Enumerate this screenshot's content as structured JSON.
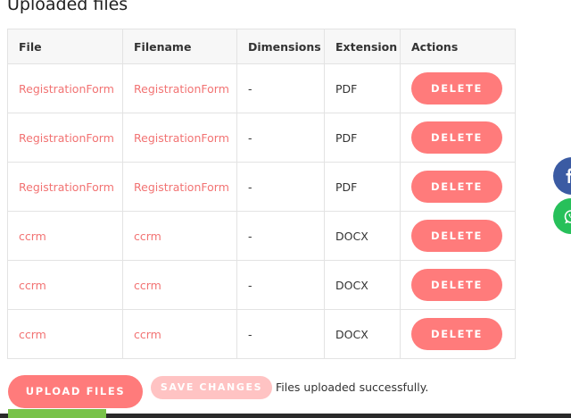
{
  "page": {
    "title": "Uploaded files"
  },
  "table": {
    "headers": {
      "file": "File",
      "filename": "Filename",
      "dimensions": "Dimensions",
      "extension": "Extension",
      "actions": "Actions"
    },
    "rows": [
      {
        "file": "RegistrationForm",
        "filename": "RegistrationForm",
        "dimensions": "-",
        "extension": "PDF",
        "action": "DELETE"
      },
      {
        "file": "RegistrationForm",
        "filename": "RegistrationForm",
        "dimensions": "-",
        "extension": "PDF",
        "action": "DELETE"
      },
      {
        "file": "RegistrationForm",
        "filename": "RegistrationForm",
        "dimensions": "-",
        "extension": "PDF",
        "action": "DELETE"
      },
      {
        "file": "ccrm",
        "filename": "ccrm",
        "dimensions": "-",
        "extension": "DOCX",
        "action": "DELETE"
      },
      {
        "file": "ccrm",
        "filename": "ccrm",
        "dimensions": "-",
        "extension": "DOCX",
        "action": "DELETE"
      },
      {
        "file": "ccrm",
        "filename": "ccrm",
        "dimensions": "-",
        "extension": "DOCX",
        "action": "DELETE"
      }
    ]
  },
  "footer": {
    "upload_label": "UPLOAD FILES",
    "save_label": "SAVE CHANGES",
    "status": "Files uploaded successfully."
  },
  "floating": {
    "facebook_icon": "facebook-icon",
    "whatsapp_icon": "whatsapp-icon"
  },
  "colors": {
    "accent": "#ff7b7b",
    "accent_disabled": "#ffc3c3",
    "link": "#f27373",
    "facebook": "#3b5ba3",
    "whatsapp": "#27c05a"
  }
}
